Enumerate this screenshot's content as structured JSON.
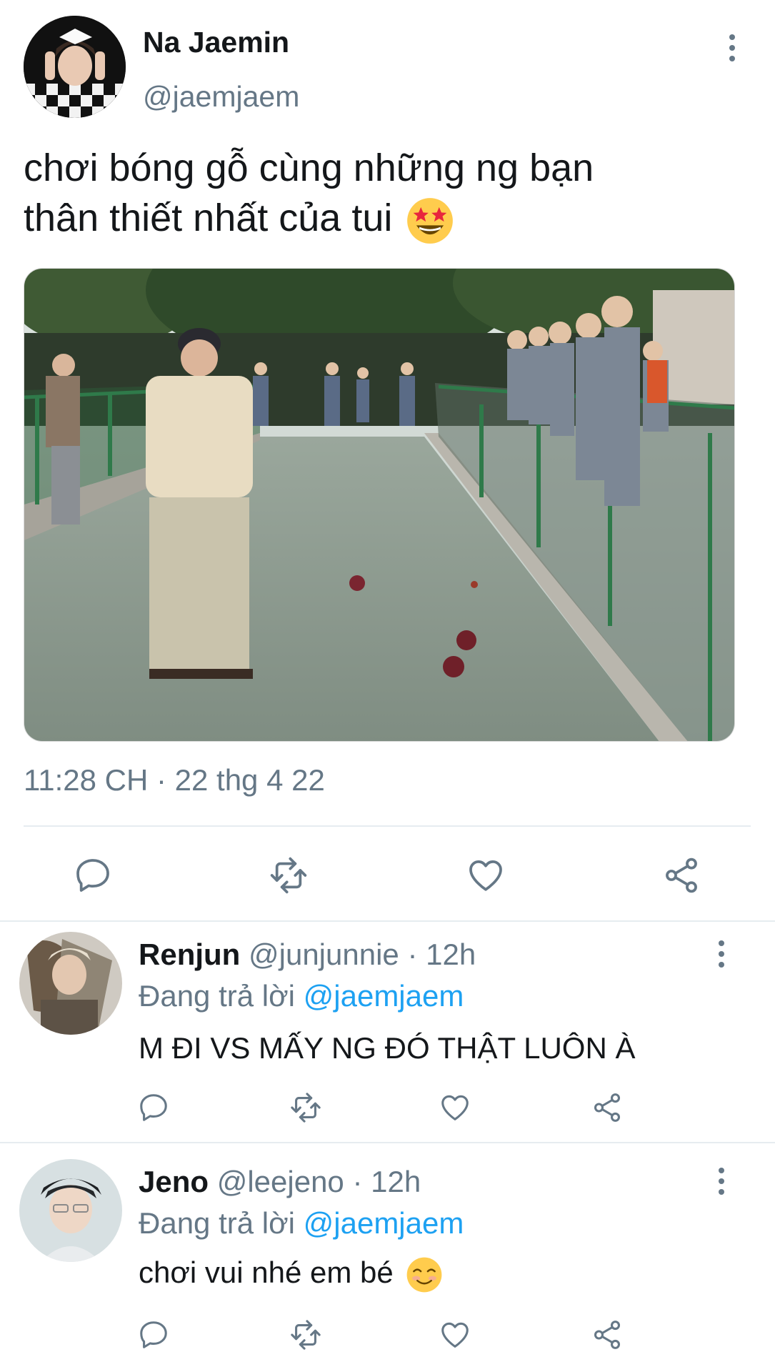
{
  "tweet": {
    "display_name": "Na Jaemin",
    "handle": "@jaemjaem",
    "text_line1": "chơi bóng gỗ cùng những ng bạn",
    "text_line2": "thân thiết nhất của tui",
    "text_emoji": "star-struck-emoji",
    "timestamp": "11:28 CH · 22 thg 4 22",
    "actions": [
      "reply-icon",
      "retweet-icon",
      "like-icon",
      "share-icon"
    ]
  },
  "replies": [
    {
      "display_name": "Renjun",
      "handle_time": "@junjunnie · 12h",
      "replying_prefix": "Đang trả lời",
      "replying_to": "@jaemjaem",
      "text": "M ĐI VS MẤY NG ĐÓ THẬT LUÔN À"
    },
    {
      "display_name": "Jeno",
      "handle_time": "@leejeno · 12h",
      "replying_prefix": "Đang trả lời",
      "replying_to": "@jaemjaem",
      "text": "chơi vui nhé em bé",
      "text_emoji": "smiling-face-emoji"
    }
  ],
  "colors": {
    "text": "#14171a",
    "secondary": "#657786",
    "link": "#1da1f2",
    "divider": "#e6ecf0"
  }
}
